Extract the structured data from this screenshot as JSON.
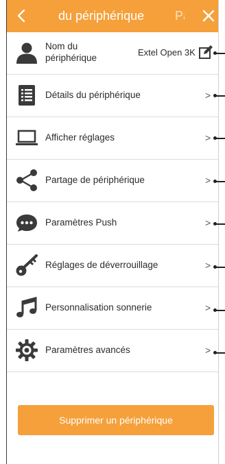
{
  "header": {
    "title": "du périphérique",
    "right_text": "Pa",
    "background": "#f5a03a",
    "back_icon": "chevron-left-icon",
    "close_icon": "close-icon"
  },
  "device_name": {
    "label": "Nom du périphérique",
    "value": "Extel Open 3K",
    "icon": "person-icon",
    "edit_icon": "edit-icon"
  },
  "menu": [
    {
      "label": "Détails du périphérique",
      "icon": "list-icon"
    },
    {
      "label": "Afficher réglages",
      "icon": "laptop-icon"
    },
    {
      "label": "Partage de périphérique",
      "icon": "share-icon"
    },
    {
      "label": "Paramètres Push",
      "icon": "chat-bubble-icon"
    },
    {
      "label": "Réglages de déverrouillage",
      "icon": "key-icon"
    },
    {
      "label": "Personnalisation sonnerie",
      "icon": "music-note-icon"
    },
    {
      "label": "Paramètres avancés",
      "icon": "gear-icon"
    }
  ],
  "chevron": ">",
  "delete_button": "Supprimer un périphérique",
  "accent_color": "#f5a03a"
}
